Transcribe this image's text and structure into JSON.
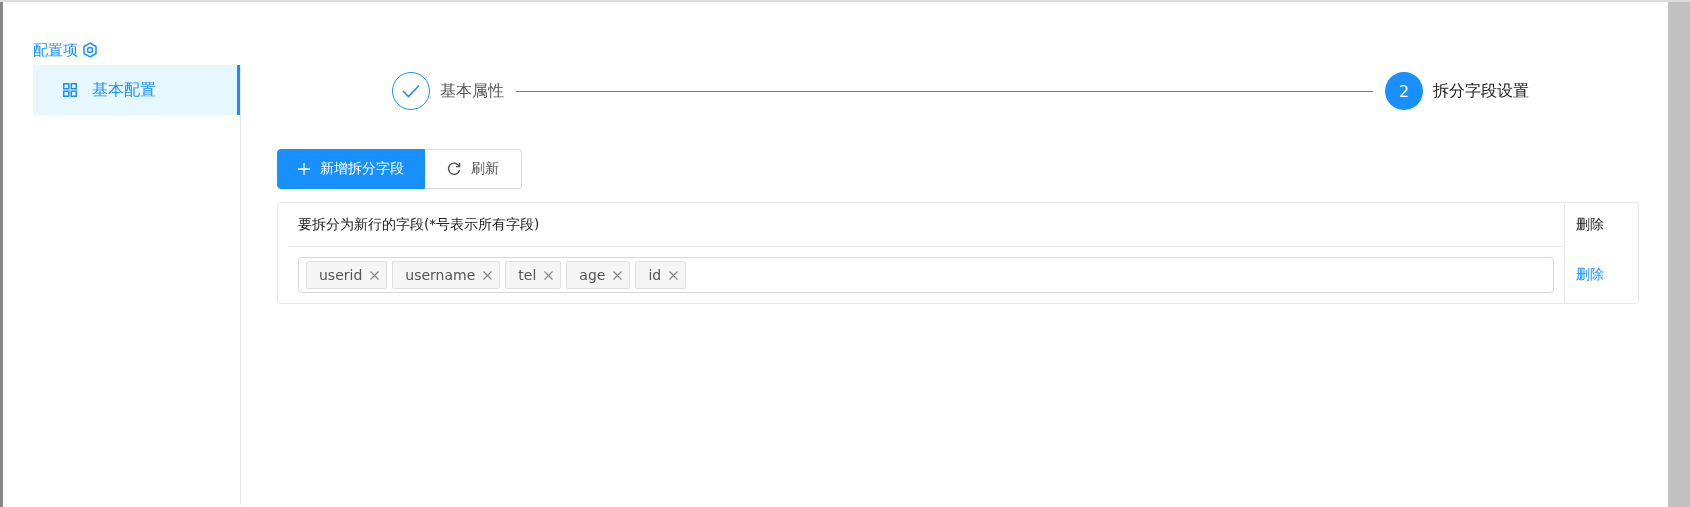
{
  "sidebar": {
    "title": "配置项",
    "items": [
      {
        "label": "基本配置",
        "selected": true
      }
    ]
  },
  "steps": [
    {
      "title": "基本属性",
      "finished": true
    },
    {
      "title": "拆分字段设置",
      "number": "2",
      "finished": false
    }
  ],
  "toolbar": {
    "buttons": [
      {
        "label": "新增拆分字段",
        "kind": "primary"
      },
      {
        "label": "刷新",
        "kind": "default"
      }
    ]
  },
  "table": {
    "columns": [
      "要拆分为新行的字段(*号表示所有字段)",
      "删除"
    ],
    "rows": [
      {
        "tags": [
          "userid",
          "username",
          "tel",
          "age",
          "id"
        ],
        "action": "删除"
      }
    ]
  }
}
